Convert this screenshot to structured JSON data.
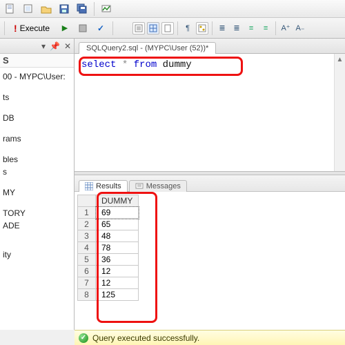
{
  "toolbar": {
    "execute_label": "Execute"
  },
  "sidebar": {
    "header_letter": "S",
    "connection": "00 - MYPC\\User:",
    "nodes": [
      "ts",
      "DB",
      "rams",
      "bles",
      "s",
      "MY",
      "TORY",
      "ADE",
      "ity"
    ]
  },
  "editor": {
    "tab_name": "SQLQuery2.sql - (MYPC\\User (52))*",
    "sql_tokens": [
      "select",
      " * ",
      "from",
      " dummy"
    ]
  },
  "results": {
    "tabs": {
      "results": "Results",
      "messages": "Messages"
    },
    "column": "DUMMY",
    "rows": [
      {
        "n": 1,
        "v": 69
      },
      {
        "n": 2,
        "v": 65
      },
      {
        "n": 3,
        "v": 48
      },
      {
        "n": 4,
        "v": 78
      },
      {
        "n": 5,
        "v": 36
      },
      {
        "n": 6,
        "v": 12
      },
      {
        "n": 7,
        "v": 12
      },
      {
        "n": 8,
        "v": 125
      }
    ]
  },
  "status": {
    "message": "Query executed successfully."
  }
}
